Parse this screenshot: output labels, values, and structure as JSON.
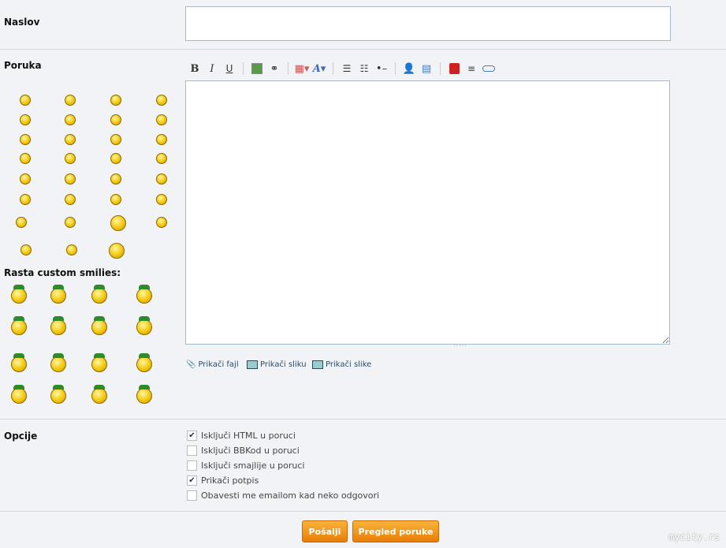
{
  "title_label": "Naslov",
  "title_value": "",
  "message_label": "Poruka",
  "custom_smilies_label": "Rasta custom smilies:",
  "attach": {
    "file": "Prikači fajl",
    "image": "Prikači sliku",
    "images": "Prikači slike"
  },
  "options_label": "Opcije",
  "options": [
    {
      "label": "Isključi HTML u poruci",
      "checked": true
    },
    {
      "label": "Isključi BBKod u poruci",
      "checked": false
    },
    {
      "label": "Isključi smajlije u poruci",
      "checked": false
    },
    {
      "label": "Prikači potpis",
      "checked": true
    },
    {
      "label": "Obavesti me emailom kad neko odgovori",
      "checked": false
    }
  ],
  "buttons": {
    "send": "Pošalji",
    "preview": "Pregled poruke"
  },
  "toolbar": {
    "bold": "B",
    "italic": "I",
    "underline": "U"
  },
  "watermark": "mycity.rs",
  "colors": {
    "accent": "#f29a1e",
    "background": "#f1f3f6"
  }
}
